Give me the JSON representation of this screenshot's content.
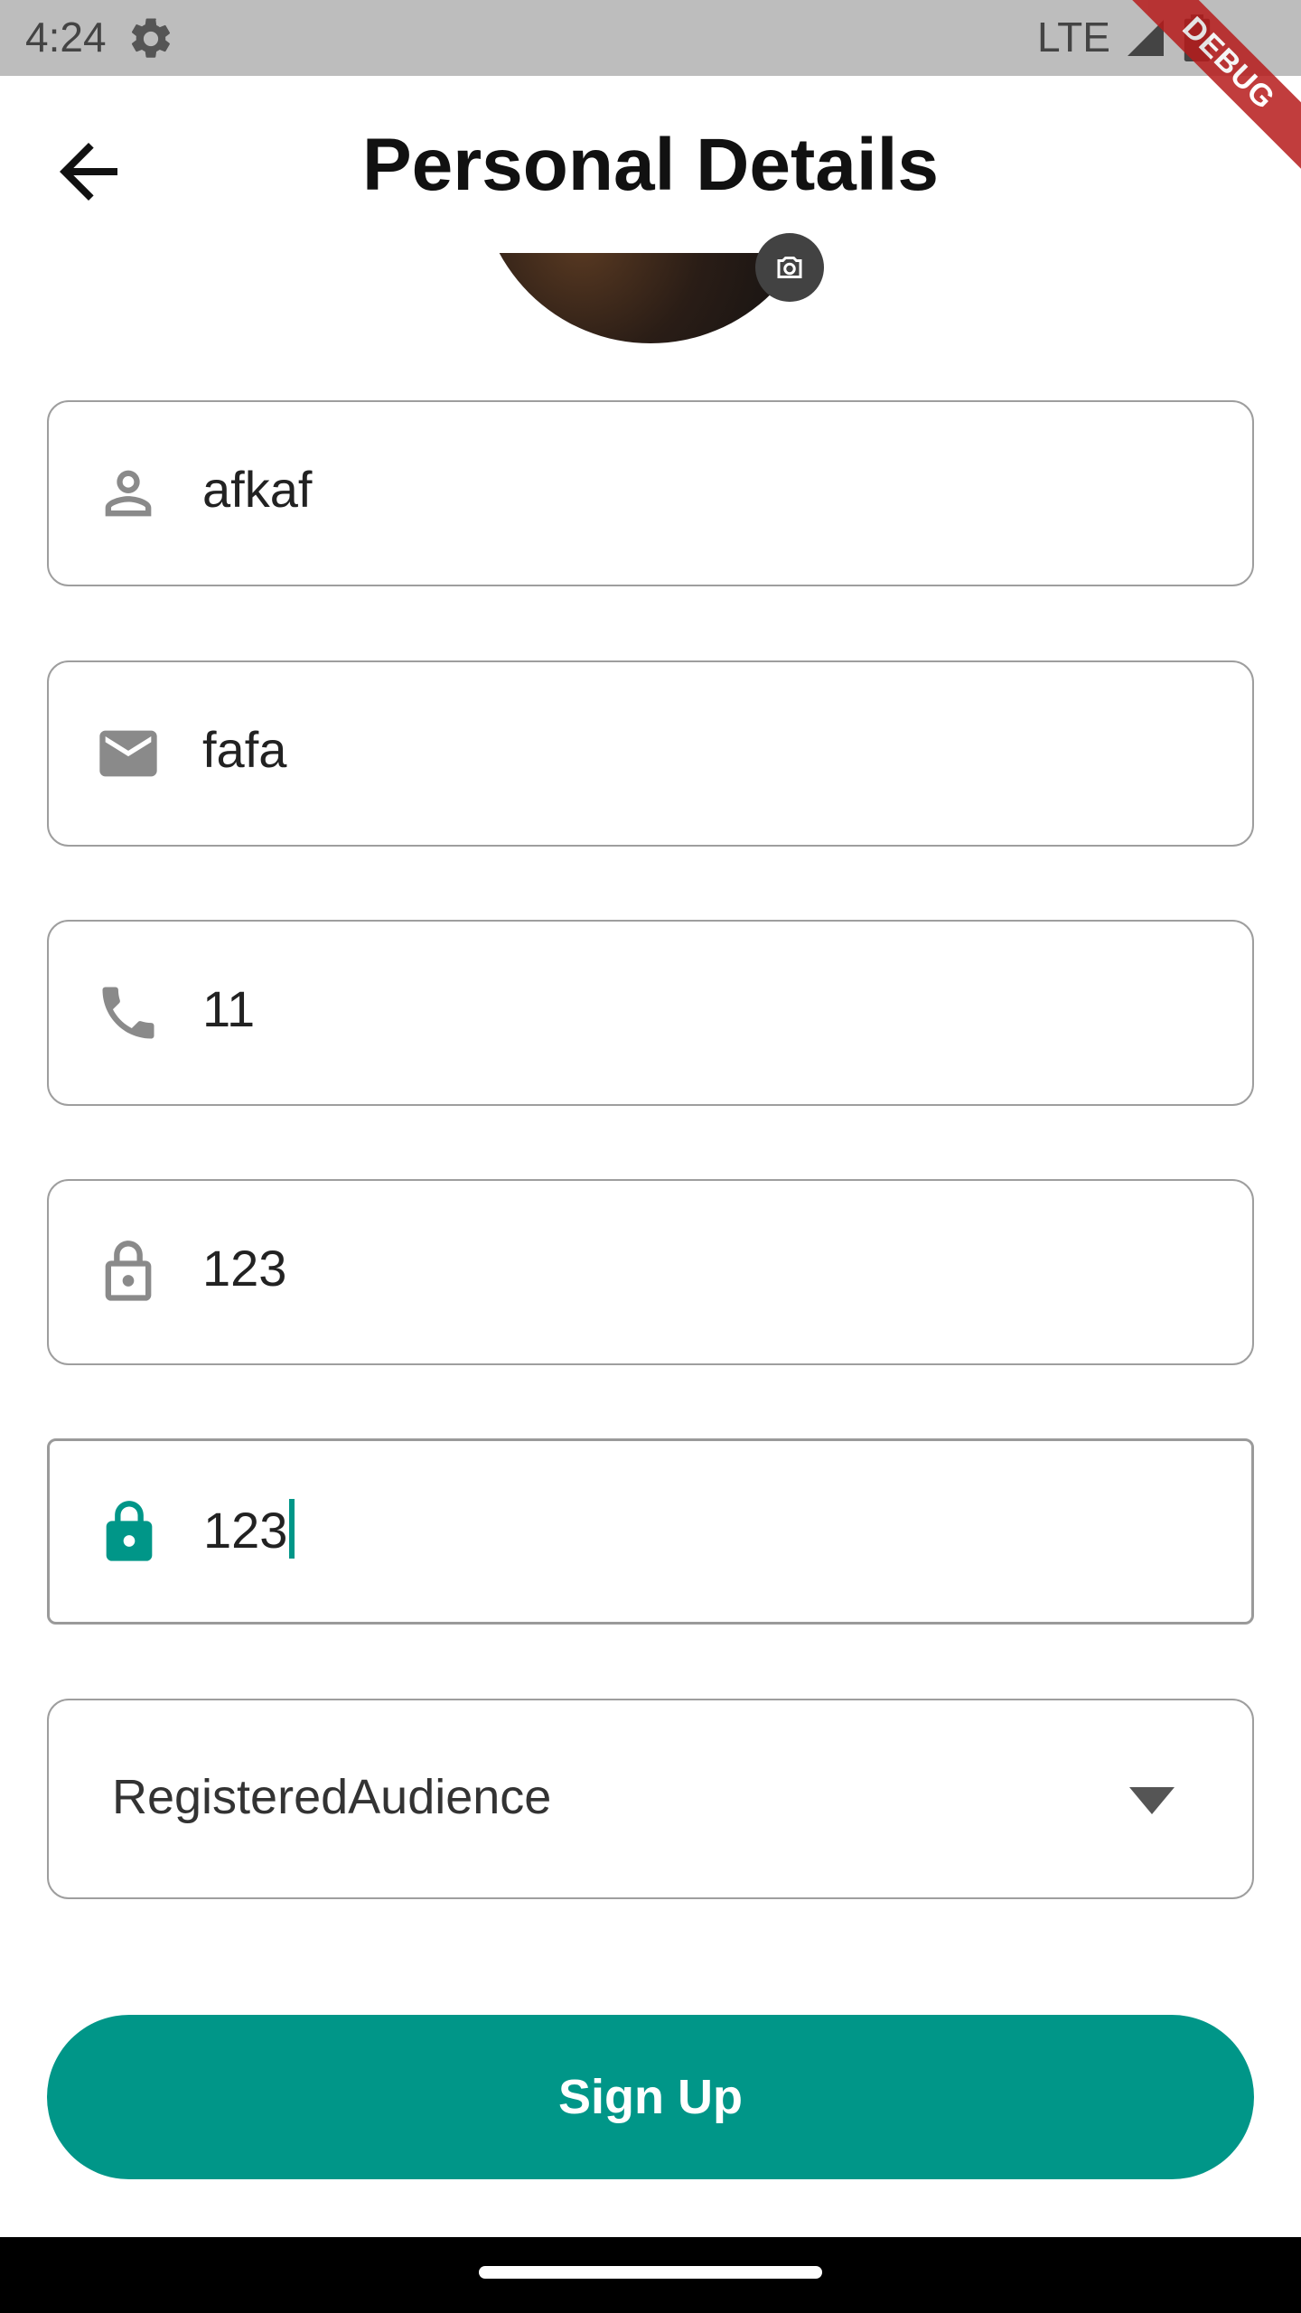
{
  "status_bar": {
    "time": "4:24",
    "network": "LTE",
    "icons": [
      "settings-gear-icon",
      "signal-icon",
      "battery-icon"
    ]
  },
  "debug_banner": "DEBUG",
  "app_bar": {
    "back_icon": "arrow-back-icon",
    "title": "Personal Details"
  },
  "avatar": {
    "camera_icon": "camera-icon"
  },
  "form": {
    "name": {
      "icon": "person-icon",
      "value": "afkaf"
    },
    "email": {
      "icon": "mail-icon",
      "value": "fafa"
    },
    "phone": {
      "icon": "phone-icon",
      "value": "11"
    },
    "password": {
      "icon": "lock-outline-icon",
      "value": "123"
    },
    "confirm_password": {
      "icon": "lock-filled-icon",
      "value": "123",
      "focused": true
    },
    "role_dropdown": {
      "value": "RegisteredAudience",
      "icon": "dropdown-arrow-icon"
    }
  },
  "actions": {
    "signup_label": "Sign Up"
  },
  "colors": {
    "accent": "#009688",
    "border": "#9e9e9e",
    "icon_gray": "#8a8a8a",
    "status_bar_bg": "#bdbdbd",
    "debug_banner": "#b71c1c"
  }
}
